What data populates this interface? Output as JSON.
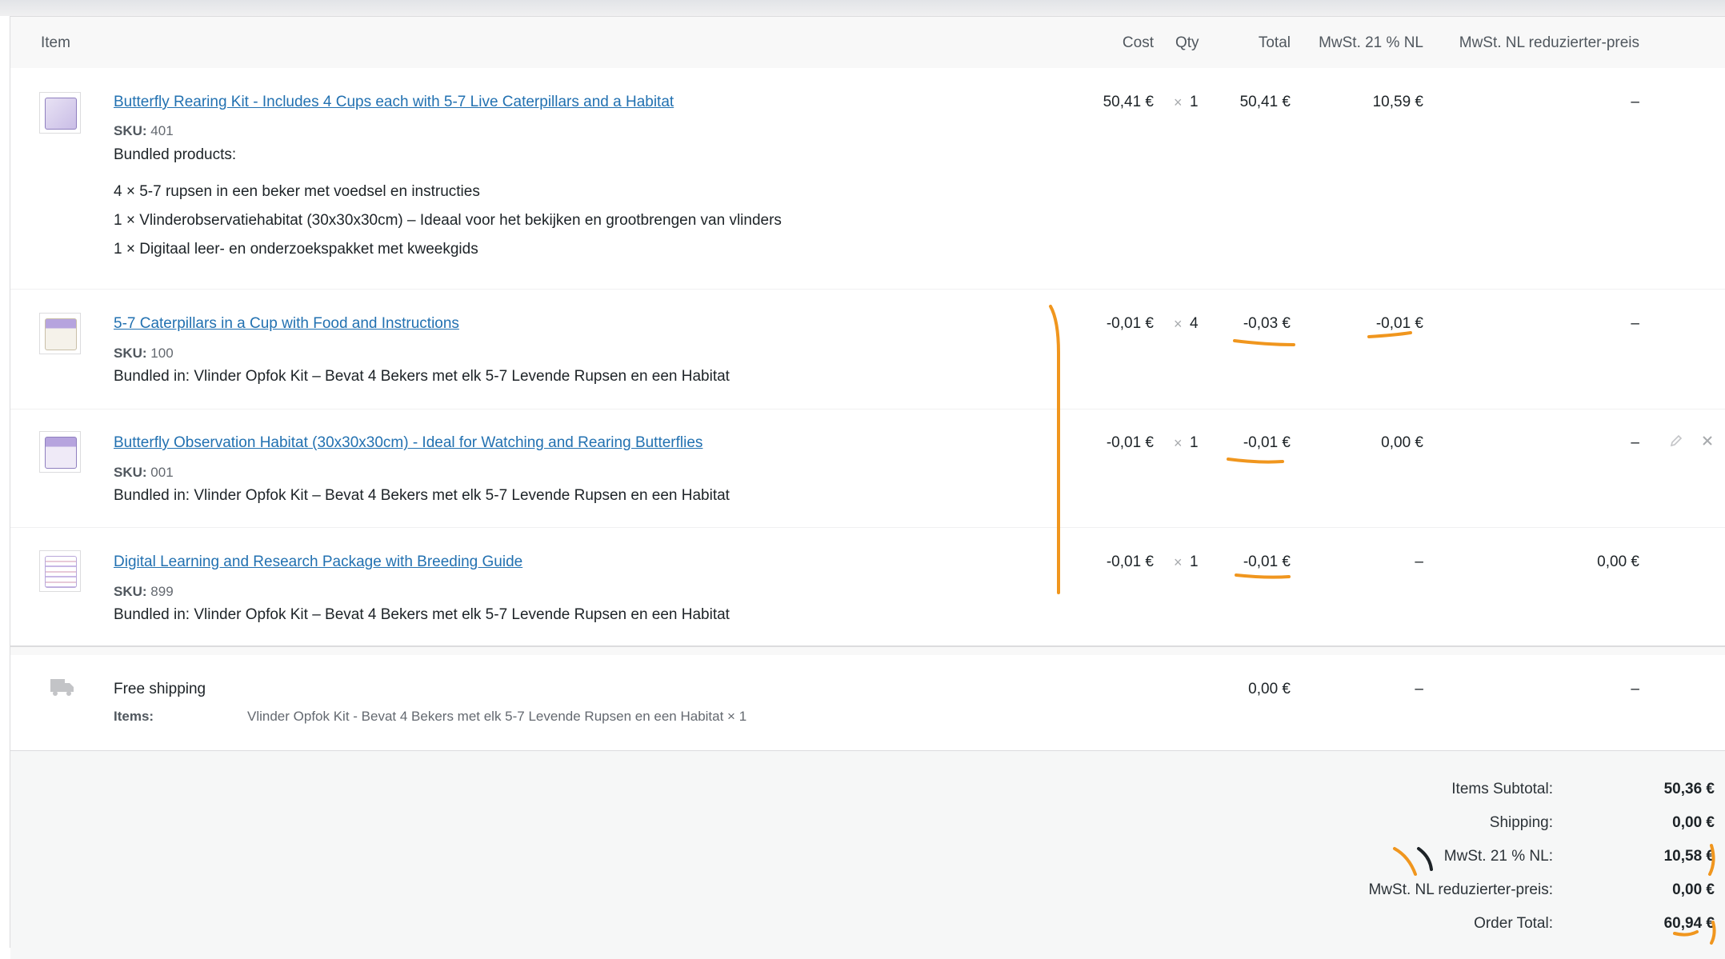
{
  "headers": {
    "item": "Item",
    "cost": "Cost",
    "qty": "Qty",
    "total": "Total",
    "tax1": "MwSt. 21 % NL",
    "tax2": "MwSt. NL reduzierter-preis"
  },
  "items": [
    {
      "name": "Butterfly Rearing Kit - Includes 4 Cups each with 5-7 Live Caterpillars and a Habitat",
      "sku_label": "SKU:",
      "sku": "401",
      "bundled_title": "Bundled products:",
      "bundled": [
        "4 × 5-7 rupsen in een beker met voedsel en instructies",
        "1 × Vlinderobservatiehabitat (30x30x30cm) – Ideaal voor het bekijken en grootbrengen van vlinders",
        "1 × Digitaal leer- en onderzoekspakket met kweekgids"
      ],
      "cost": "50,41 €",
      "qty_symbol": "×",
      "qty": "1",
      "total": "50,41 €",
      "tax1": "10,59 €",
      "tax2": "–"
    },
    {
      "name": "5-7 Caterpillars in a Cup with Food and Instructions",
      "sku_label": "SKU:",
      "sku": "100",
      "bundled_in": "Bundled in: Vlinder Opfok Kit – Bevat 4 Bekers met elk 5-7 Levende Rupsen en een Habitat",
      "cost": "-0,01 €",
      "qty_symbol": "×",
      "qty": "4",
      "total": "-0,03 €",
      "tax1": "-0,01 €",
      "tax2": "–"
    },
    {
      "name": "Butterfly Observation Habitat (30x30x30cm) - Ideal for Watching and Rearing Butterflies",
      "sku_label": "SKU:",
      "sku": "001",
      "bundled_in": "Bundled in: Vlinder Opfok Kit – Bevat 4 Bekers met elk 5-7 Levende Rupsen en een Habitat",
      "cost": "-0,01 €",
      "qty_symbol": "×",
      "qty": "1",
      "total": "-0,01 €",
      "tax1": "0,00 €",
      "tax2": "–"
    },
    {
      "name": "Digital Learning and Research Package with Breeding Guide",
      "sku_label": "SKU:",
      "sku": "899",
      "bundled_in": "Bundled in: Vlinder Opfok Kit – Bevat 4 Bekers met elk 5-7 Levende Rupsen en een Habitat",
      "cost": "-0,01 €",
      "qty_symbol": "×",
      "qty": "1",
      "total": "-0,01 €",
      "tax1": "–",
      "tax2": "0,00 €"
    }
  ],
  "shipping": {
    "method": "Free shipping",
    "items_label": "Items:",
    "items_value": "Vlinder Opfok Kit - Bevat 4 Bekers met elk 5-7 Levende Rupsen en een Habitat × 1",
    "total": "0,00 €",
    "tax1": "–",
    "tax2": "–"
  },
  "totals": [
    {
      "label": "Items Subtotal:",
      "value": "50,36 €"
    },
    {
      "label": "Shipping:",
      "value": "0,00 €"
    },
    {
      "label": "MwSt. 21 % NL:",
      "value": "10,58 €"
    },
    {
      "label": "MwSt. NL reduzierter-preis:",
      "value": "0,00 €"
    },
    {
      "label": "Order Total:",
      "value": "60,94 €"
    }
  ],
  "icons": {
    "edit": "pencil-icon",
    "delete": "close-icon",
    "shipping": "truck-icon"
  },
  "colors": {
    "link": "#2271b1",
    "annotation": "#f0961e"
  }
}
